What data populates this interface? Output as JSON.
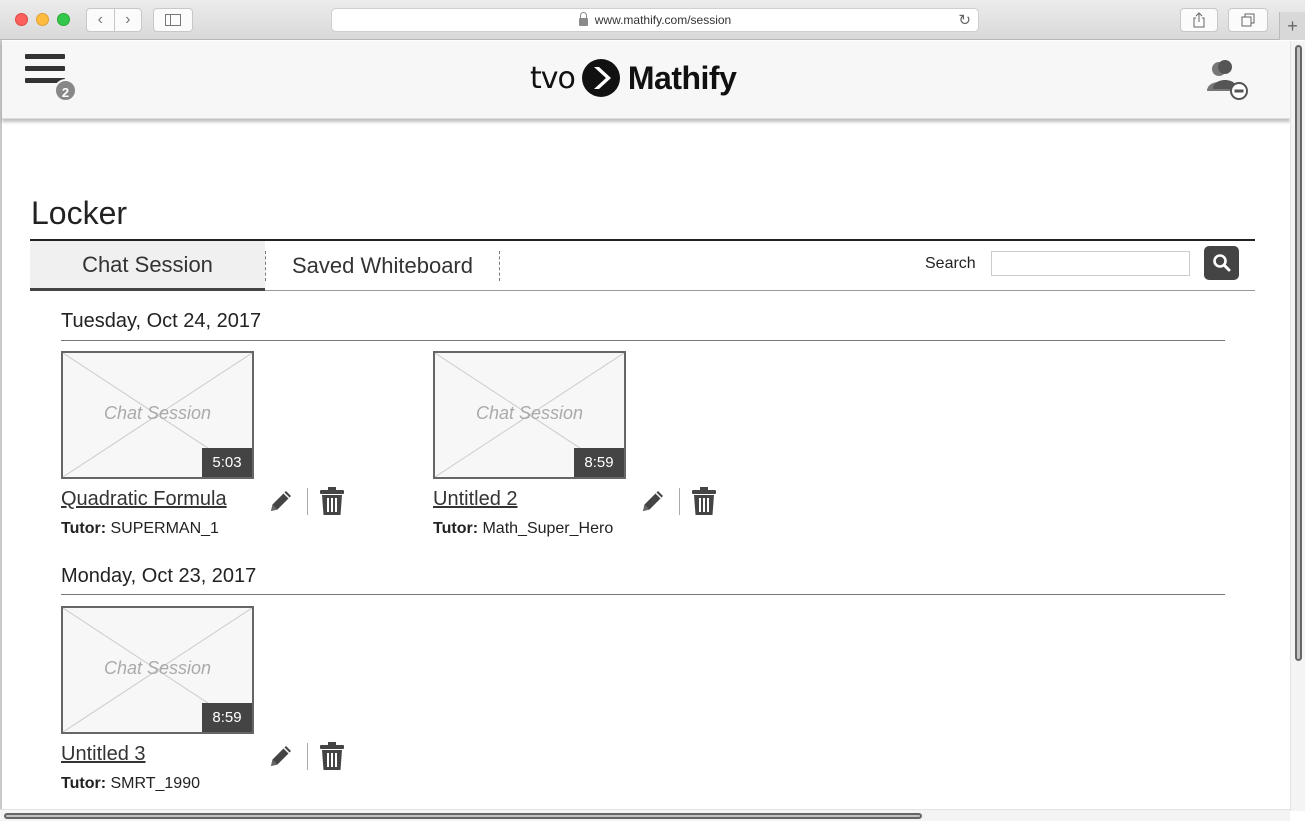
{
  "browser": {
    "url": "www.mathify.com/session",
    "back_glyph": "‹",
    "forward_glyph": "›",
    "reload_glyph": "↻",
    "new_tab_glyph": "+"
  },
  "header": {
    "menu_badge": "2",
    "logo_prefix": "tvo",
    "logo_brand": "Mathify",
    "user_icon": "user-settings-icon"
  },
  "page": {
    "title": "Locker"
  },
  "tabs": {
    "chat_session": "Chat Session",
    "saved_whiteboard": "Saved Whiteboard"
  },
  "search": {
    "label": "Search",
    "value": "",
    "placeholder": ""
  },
  "groups": [
    {
      "date": "Tuesday, Oct 24, 2017",
      "sessions": [
        {
          "thumb_label": "Chat Session",
          "duration": "5:03",
          "title": "Quadratic Formula",
          "tutor_label": "Tutor:",
          "tutor": "SUPERMAN_1"
        },
        {
          "thumb_label": "Chat Session",
          "duration": "8:59",
          "title": "Untitled 2",
          "tutor_label": "Tutor:",
          "tutor": "Math_Super_Hero"
        }
      ]
    },
    {
      "date": "Monday, Oct 23, 2017",
      "sessions": [
        {
          "thumb_label": "Chat Session",
          "duration": "8:59",
          "title": "Untitled 3",
          "tutor_label": "Tutor:",
          "tutor": "SMRT_1990"
        }
      ]
    }
  ],
  "colors": {
    "dark": "#444444",
    "accent_text": "#333333",
    "traffic_red": "#fc605c",
    "traffic_yellow": "#fdbc40",
    "traffic_green": "#34c84a"
  }
}
